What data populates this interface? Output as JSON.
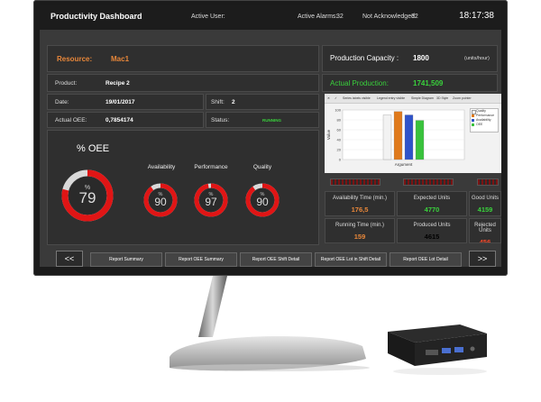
{
  "header": {
    "title": "Productivity Dashboard",
    "active_user_label": "Active User:",
    "active_alarms_label": "Active Alarms:",
    "active_alarms_value": "32",
    "not_ack_label": "Not Acknowledged:",
    "not_ack_value": "32",
    "clock": "18:17:38"
  },
  "info": {
    "resource_label": "Resource:",
    "resource_value": "Mac1",
    "product_label": "Product:",
    "product_value": "Recipe 2",
    "date_label": "Date:",
    "date_value": "19/01/2017",
    "shift_label": "Shift:",
    "shift_value": "2",
    "oee_label": "Actual OEE:",
    "oee_value": "0,7854174",
    "status_label": "Status:",
    "status_value": "RUNNING"
  },
  "production": {
    "capacity_label": "Production Capacity :",
    "capacity_value": "1800",
    "capacity_unit": "(units/hour)",
    "actual_label": "Actual Production:",
    "actual_value": "1741,509"
  },
  "gauges": {
    "oee_title": "% OEE",
    "oee": {
      "symbol": "%",
      "value": "79",
      "fraction": 0.79
    },
    "availability": {
      "label": "Availability",
      "symbol": "%",
      "value": "90",
      "fraction": 0.9
    },
    "performance": {
      "label": "Performance",
      "symbol": "%",
      "value": "97",
      "fraction": 0.97
    },
    "quality": {
      "label": "Quality",
      "symbol": "%",
      "value": "90",
      "fraction": 0.9
    }
  },
  "chart_data": {
    "type": "bar",
    "categories": [
      "Argument"
    ],
    "series": [
      {
        "name": "Quality",
        "values": [
          90
        ]
      },
      {
        "name": "Performance",
        "values": [
          97
        ]
      },
      {
        "name": "Availability",
        "values": [
          90
        ]
      },
      {
        "name": "OEE",
        "values": [
          79
        ]
      }
    ],
    "series_colors": [
      "#f2f2f2",
      "#e07a1c",
      "#2f53c9",
      "#39c23c"
    ],
    "xlabel": "Argument",
    "ylabel": "Value",
    "ylim": [
      0,
      100
    ],
    "y_ticks": [
      "100",
      "80",
      "60",
      "40",
      "20",
      "0"
    ],
    "legend": "top-right",
    "toolbar": [
      "Series labels visible",
      "Legend entry visible",
      "Simple Diagram",
      "3D Style",
      "Zoom pointer"
    ]
  },
  "stats": {
    "availability_time": {
      "label": "Availability Time (min.)",
      "value": "176,5"
    },
    "expected_units": {
      "label": "Expected Units",
      "value": "4770"
    },
    "good_units": {
      "label": "Good Units",
      "value": "4159"
    },
    "running_time": {
      "label": "Running Time (min.)",
      "value": "159"
    },
    "produced_units": {
      "label": "Produced Units",
      "value": "4615"
    },
    "rejected_units": {
      "label": "Rejected Units",
      "value": "456"
    }
  },
  "nav": {
    "prev": "<<",
    "next": ">>",
    "buttons": [
      "Report Summary",
      "Report OEE Summary",
      "Report OEE Shift Detail",
      "Report OEE Lot in Shift Detail",
      "Report OEE Lot Detail"
    ]
  },
  "colors": {
    "accent_orange": "#e8873a",
    "status_green": "#39d13c",
    "alarm_red": "#ff4a2a",
    "gauge_red": "#e01515"
  }
}
